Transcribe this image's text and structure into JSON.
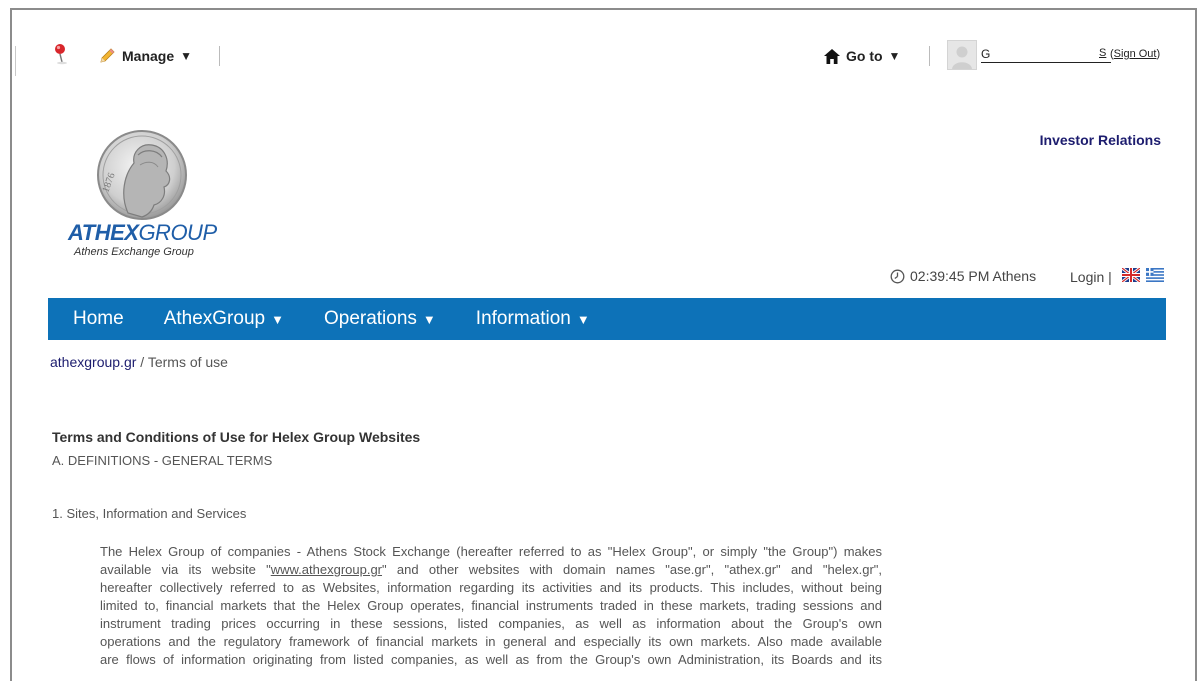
{
  "toolbar": {
    "manage_label": "Manage",
    "manage_caret": "▼",
    "goto_label": "Go to",
    "goto_caret": "▼",
    "user_name": "G",
    "user_name_end": "S",
    "sign_out_open": "(",
    "sign_out_label": "Sign Out",
    "sign_out_close": ")"
  },
  "logo": {
    "word_bold": "ATHEX",
    "word_light": "GROUP",
    "subtitle": "Athens Exchange Group",
    "coin_text": "1876"
  },
  "header": {
    "investor_relations": "Investor Relations",
    "clock_time": "02:39:45 PM Athens",
    "login_label": "Login |"
  },
  "nav": {
    "items": [
      {
        "label": "Home",
        "caret": ""
      },
      {
        "label": "AthexGroup",
        "caret": "▼"
      },
      {
        "label": "Operations",
        "caret": "▼"
      },
      {
        "label": "Information",
        "caret": "▼"
      }
    ]
  },
  "breadcrumb": {
    "root": "athexgroup.gr",
    "sep": " / ",
    "current": "Terms of use"
  },
  "content": {
    "title": "Terms and Conditions of Use for Helex Group Websites",
    "section": "A. DEFINITIONS - GENERAL TERMS",
    "subsection": "1. Sites, Information and Services",
    "lines": [
      "The Helex Group of companies - Athens Stock Exchange (hereafter referred to as \"Helex Group\", or simply \"the Group\") makes",
      "",
      "hereafter collectively referred to as Websites, information regarding its activities and its products. This includes, without being",
      "limited to, financial markets that the Helex Group operates, financial instruments traded in these markets, trading sessions and",
      "instrument trading prices occurring in these sessions, listed companies, as well as information about the Group's own",
      "operations and the regulatory framework of financial markets in general and especially its own markets. Also made available",
      "are flows of information originating from listed companies, as well as from the Group's own Administration, its Boards and its"
    ],
    "line2_before": "available via its website \"",
    "line2_link": "www.athexgroup.gr",
    "line2_after": "\" and other websites with domain names \"ase.gr\", \"athex.gr\" and \"helex.gr\","
  },
  "colors": {
    "nav_bg": "#0d72b8",
    "ir_link": "#1c1c6e",
    "logo_blue": "#1f5ea8"
  }
}
